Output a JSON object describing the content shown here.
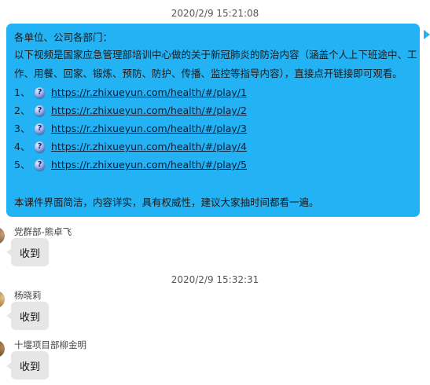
{
  "timestamps": [
    "2020/2/9 15:21:08",
    "2020/2/9 15:32:31"
  ],
  "notice": {
    "greeting": "各单位、公司各部门：",
    "body_line1": "以下视频是国家应急管理部培训中心做的关于新冠肺炎的防治内容（涵盖个人上下班途中、工",
    "body_line2": "作、用餐、回家、锻炼、预防、防护、传播、监控等指导内容），直接点开链接即可观看。",
    "links": [
      {
        "num": "1、",
        "url": "https://r.zhixueyun.com/health/#/play/1"
      },
      {
        "num": "2、",
        "url": "https://r.zhixueyun.com/health/#/play/2"
      },
      {
        "num": "3、",
        "url": "https://r.zhixueyun.com/health/#/play/3"
      },
      {
        "num": "4、",
        "url": "https://r.zhixueyun.com/health/#/play/4"
      },
      {
        "num": "5、",
        "url": "https://r.zhixueyun.com/health/#/play/5"
      }
    ],
    "closing": "本课件界面简洁，内容详实，具有权威性，建议大家抽时间都看一遍。",
    "link_icon": "question-icon",
    "bubble_color": "#23b2f3"
  },
  "replies": [
    {
      "sender": "党群部-熊卓飞",
      "text": "收到"
    },
    {
      "sender": "杨晓莉",
      "text": "收到"
    },
    {
      "sender": "十堰项目部柳金明",
      "text": "收到"
    }
  ]
}
